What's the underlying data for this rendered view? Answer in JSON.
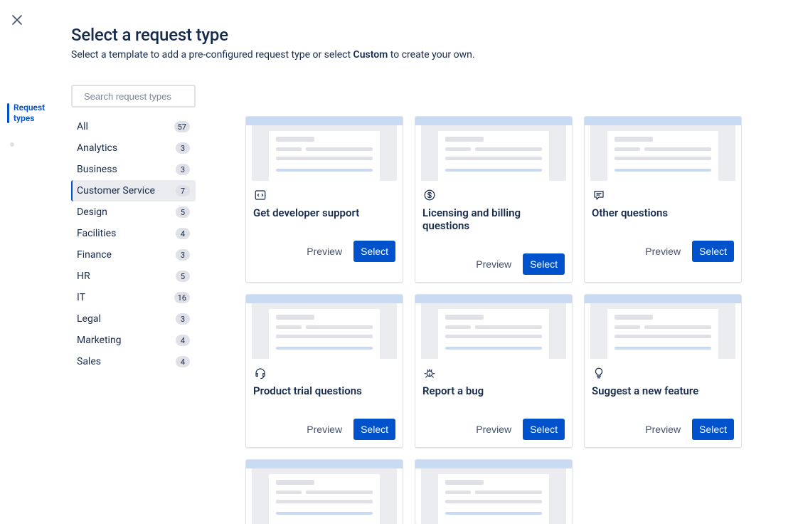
{
  "close_label": "Close",
  "rail": [
    {
      "label": "Request types",
      "active": true
    },
    {
      "label": "",
      "active": false
    }
  ],
  "header": {
    "title": "Select a request type",
    "subtitle_pre": "Select a template to add a pre-configured request type or select ",
    "subtitle_bold": "Custom",
    "subtitle_post": " to create your own."
  },
  "search": {
    "placeholder": "Search request types"
  },
  "categories": [
    {
      "label": "All",
      "count": 57,
      "active": false
    },
    {
      "label": "Analytics",
      "count": 3,
      "active": false
    },
    {
      "label": "Business",
      "count": 3,
      "active": false
    },
    {
      "label": "Customer Service",
      "count": 7,
      "active": true
    },
    {
      "label": "Design",
      "count": 5,
      "active": false
    },
    {
      "label": "Facilities",
      "count": 4,
      "active": false
    },
    {
      "label": "Finance",
      "count": 3,
      "active": false
    },
    {
      "label": "HR",
      "count": 5,
      "active": false
    },
    {
      "label": "IT",
      "count": 16,
      "active": false
    },
    {
      "label": "Legal",
      "count": 3,
      "active": false
    },
    {
      "label": "Marketing",
      "count": 4,
      "active": false
    },
    {
      "label": "Sales",
      "count": 4,
      "active": false
    }
  ],
  "actions": {
    "preview": "Preview",
    "select": "Select"
  },
  "cards": [
    {
      "icon": "code",
      "title": "Get developer support"
    },
    {
      "icon": "dollar",
      "title": "Licensing and billing questions"
    },
    {
      "icon": "comment",
      "title": "Other questions"
    },
    {
      "icon": "headset",
      "title": "Product trial questions"
    },
    {
      "icon": "bug",
      "title": "Report a bug"
    },
    {
      "icon": "bulb",
      "title": "Suggest a new feature"
    },
    {
      "icon": "book",
      "title": ""
    },
    {
      "icon": "lock",
      "title": ""
    }
  ]
}
